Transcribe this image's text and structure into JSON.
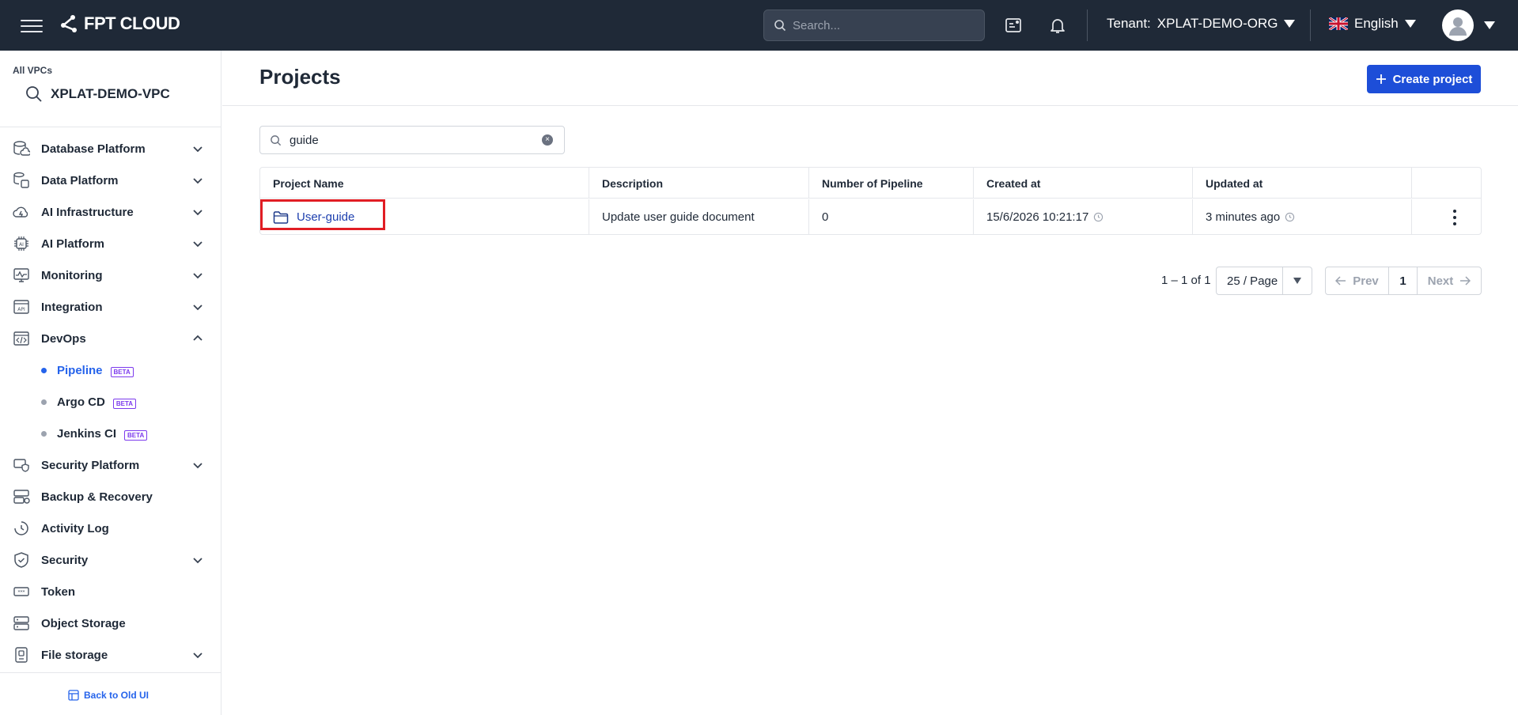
{
  "topbar": {
    "brand": "FPT CLOUD",
    "search_placeholder": "Search...",
    "tenant_label": "Tenant:",
    "tenant_value": "XPLAT-DEMO-ORG",
    "language": "English"
  },
  "sidebar": {
    "vpc_label": "All VPCs",
    "vpc_name": "XPLAT-DEMO-VPC",
    "items": [
      {
        "label": "Database Platform",
        "icon": "database-cloud-icon",
        "expandable": true
      },
      {
        "label": "Data Platform",
        "icon": "data-stack-icon",
        "expandable": true
      },
      {
        "label": "AI Infrastructure",
        "icon": "ai-infra-icon",
        "expandable": true
      },
      {
        "label": "AI Platform",
        "icon": "ai-chip-icon",
        "expandable": true
      },
      {
        "label": "Monitoring",
        "icon": "monitor-icon",
        "expandable": true
      },
      {
        "label": "Integration",
        "icon": "api-icon",
        "expandable": true
      },
      {
        "label": "DevOps",
        "icon": "devops-icon",
        "expandable": true,
        "expanded": true
      }
    ],
    "devops_children": [
      {
        "label": "Pipeline",
        "badge": "BETA",
        "active": true
      },
      {
        "label": "Argo CD",
        "badge": "BETA",
        "active": false
      },
      {
        "label": "Jenkins CI",
        "badge": "BETA",
        "active": false
      }
    ],
    "items_after": [
      {
        "label": "Security Platform",
        "icon": "security-platform-icon",
        "expandable": true
      },
      {
        "label": "Backup & Recovery",
        "icon": "backup-icon",
        "expandable": false
      },
      {
        "label": "Activity Log",
        "icon": "clock-icon",
        "expandable": false
      },
      {
        "label": "Security",
        "icon": "shield-icon",
        "expandable": true
      },
      {
        "label": "Token",
        "icon": "token-icon",
        "expandable": false
      },
      {
        "label": "Object Storage",
        "icon": "storage-icon",
        "expandable": false
      },
      {
        "label": "File storage",
        "icon": "file-storage-icon",
        "expandable": true
      }
    ],
    "back_old_ui": "Back to Old UI"
  },
  "main": {
    "title": "Projects",
    "create_button": "Create project",
    "filter_value": "guide",
    "table": {
      "headers": [
        "Project Name",
        "Description",
        "Number of Pipeline",
        "Created at",
        "Updated at"
      ],
      "rows": [
        {
          "name": "User-guide",
          "description": "Update user guide document",
          "pipelines": "0",
          "created_at": "15/6/2026 10:21:17",
          "updated_at": "3 minutes ago"
        }
      ]
    },
    "pagination": {
      "info": "1 – 1 of 1",
      "page_size": "25 / Page",
      "prev": "Prev",
      "current": "1",
      "next": "Next"
    }
  },
  "colors": {
    "topbar_bg": "#1f2937",
    "primary": "#1d4ed8",
    "highlight": "#e11d24",
    "beta": "#7c3aed"
  }
}
